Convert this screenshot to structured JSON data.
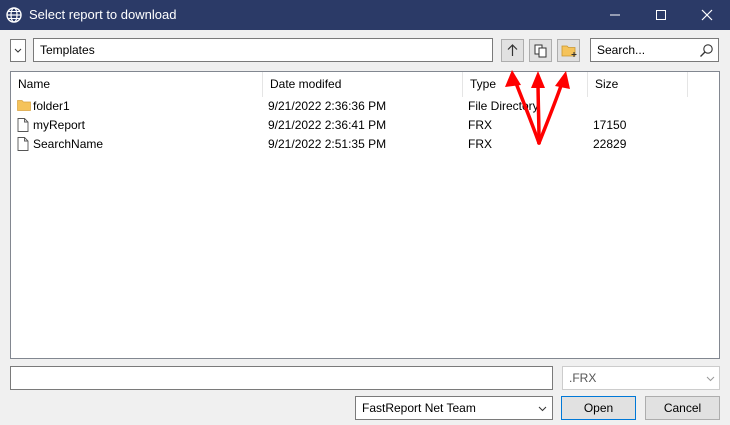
{
  "window": {
    "title": "Select report to download",
    "minimize_glyph": "—",
    "maximize_glyph": "☐",
    "close_glyph": "✕"
  },
  "toolbar": {
    "path_value": "Templates",
    "search_placeholder": "Search...",
    "buttons": [
      "up-arrow-icon",
      "copy-icon",
      "new-folder-icon"
    ]
  },
  "table": {
    "columns": [
      "Name",
      "Date modifed",
      "Type",
      "Size"
    ],
    "rows": [
      {
        "icon": "folder-icon",
        "name": "folder1",
        "date": "9/21/2022 2:36:36 PM",
        "type": "File Directory",
        "size": ""
      },
      {
        "icon": "file-icon",
        "name": "myReport",
        "date": "9/21/2022 2:36:41 PM",
        "type": "FRX",
        "size": "17150"
      },
      {
        "icon": "file-icon",
        "name": "SearchName",
        "date": "9/21/2022 2:51:35 PM",
        "type": "FRX",
        "size": "22829"
      }
    ]
  },
  "bottom": {
    "filename_value": "",
    "filetype_value": ".FRX",
    "connection_value": "FastReport Net Team",
    "open_label": "Open",
    "cancel_label": "Cancel"
  },
  "colors": {
    "titlebar": "#2b3a67",
    "annotation": "#ff0000",
    "folder": "#f5c35a"
  }
}
